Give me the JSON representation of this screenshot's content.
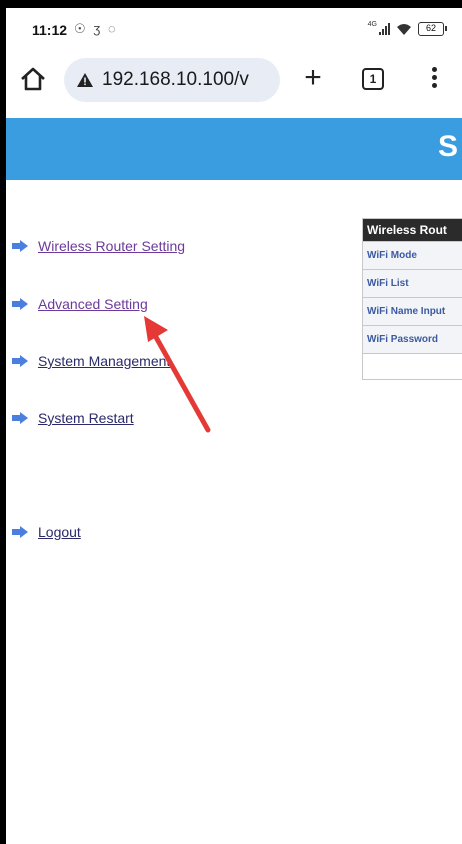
{
  "status_bar": {
    "time": "11:12",
    "left_icons": "☉ ʒ ◌",
    "network_label": "4G",
    "battery": "62"
  },
  "browser": {
    "url": "192.168.10.100/v",
    "tab_count": "1",
    "icons": [
      "home-icon",
      "warning-icon",
      "plus-icon",
      "tabs-icon",
      "more-menu-icon"
    ]
  },
  "page": {
    "header_title": "S",
    "header_color": "#3a9de0"
  },
  "nav": {
    "items": [
      {
        "label": "Wireless Router Setting"
      },
      {
        "label": "Advanced Setting"
      },
      {
        "label": "System Management"
      },
      {
        "label": "System Restart"
      },
      {
        "label": "Logout"
      }
    ]
  },
  "settings_panel": {
    "title": "Wireless Rout",
    "rows": [
      {
        "label": "WiFi Mode"
      },
      {
        "label": "WiFi List"
      },
      {
        "label": "WiFi Name Input"
      },
      {
        "label": "WiFi Password"
      }
    ]
  },
  "annotation": {
    "color": "#e53935"
  }
}
